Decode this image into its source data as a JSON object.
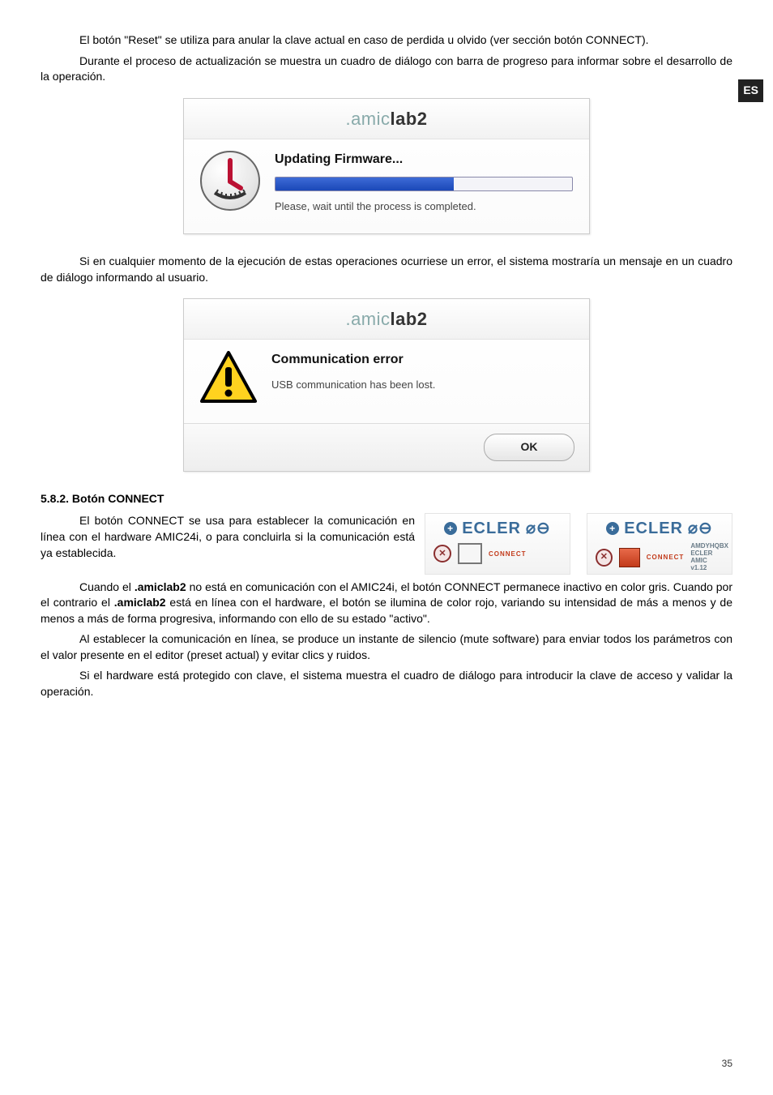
{
  "es_badge": "ES",
  "intro": {
    "p1": "El botón \"Reset\" se utiliza para anular la clave actual en caso de perdida u olvido (ver sección botón CONNECT).",
    "p2": "Durante el proceso de actualización se muestra un cuadro de diálogo con barra de progreso para informar sobre el desarrollo de la operación."
  },
  "dialog1": {
    "title_amic": ".amic",
    "title_lab": "lab2",
    "heading": "Updating Firmware...",
    "subtext": "Please, wait until the process is completed."
  },
  "mid_para": "Si en cualquier momento de la ejecución de estas operaciones ocurriese un error, el sistema mostraría un mensaje en un cuadro de diálogo informando al usuario.",
  "dialog2": {
    "title_amic": ".amic",
    "title_lab": "lab2",
    "heading": "Communication error",
    "subtext": "USB communication has been lost.",
    "ok": "OK"
  },
  "section_heading": "5.8.2. Botón CONNECT",
  "logos": {
    "brand": "ECLER",
    "connect": "CONNECT",
    "meta1": "AMDYHQBX",
    "meta2": "ECLER AMIC",
    "meta3": "v1.12"
  },
  "connect": {
    "p1a": "El botón CONNECT se usa para establecer la comunicación en línea con el hardware AMIC24i, o para concluirla si la comunicación está ya establecida.",
    "p2a": "Cuando el ",
    "p2b": ".amiclab2",
    "p2c": " no está en comunicación con el AMIC24i, el botón CONNECT permanece inactivo en color gris. Cuando por el contrario el ",
    "p2d": ".amiclab2",
    "p2e": " está en línea con el hardware, el botón se ilumina de color rojo, variando su intensidad de más a menos y de menos a más de forma progresiva, informando con ello de su estado \"activo\".",
    "p3": "Al establecer la comunicación en línea, se produce un instante de silencio (mute software) para enviar todos los parámetros con el valor presente en el editor (preset actual) y evitar clics y ruidos.",
    "p4": "Si el hardware está protegido con clave, el sistema muestra el cuadro de diálogo para introducir la clave de acceso y validar la operación."
  },
  "page_no": "35"
}
